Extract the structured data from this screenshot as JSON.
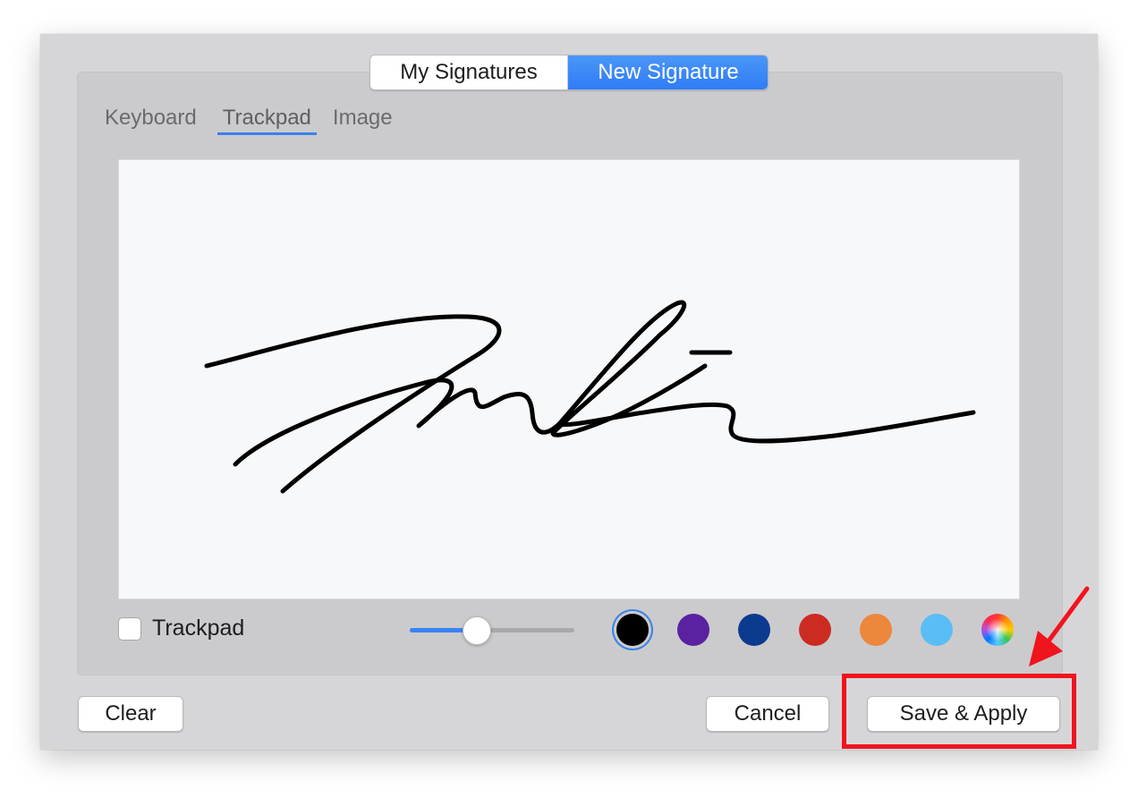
{
  "segmented_control": {
    "my_signatures": "My Signatures",
    "new_signature": "New Signature",
    "selected": "New Signature"
  },
  "tabs": [
    {
      "label": "Keyboard"
    },
    {
      "label": "Trackpad"
    },
    {
      "label": "Image"
    }
  ],
  "active_tab": "Trackpad",
  "trackpad_checkbox": {
    "label": "Trackpad",
    "checked": false
  },
  "stroke_width_slider": {
    "value": 0.38
  },
  "colors": [
    {
      "name": "black",
      "hex": "#000000",
      "selected": true
    },
    {
      "name": "purple",
      "hex": "#5a22a0"
    },
    {
      "name": "navy",
      "hex": "#0c3a8e"
    },
    {
      "name": "red",
      "hex": "#cc2b22"
    },
    {
      "name": "orange",
      "hex": "#ec873b"
    },
    {
      "name": "light-blue",
      "hex": "#5bbdf5"
    },
    {
      "name": "color-picker",
      "icon": "color-wheel-icon"
    }
  ],
  "buttons": {
    "clear": "Clear",
    "cancel": "Cancel",
    "save_apply": "Save & Apply"
  },
  "annotation": {
    "color": "#f0141e"
  }
}
